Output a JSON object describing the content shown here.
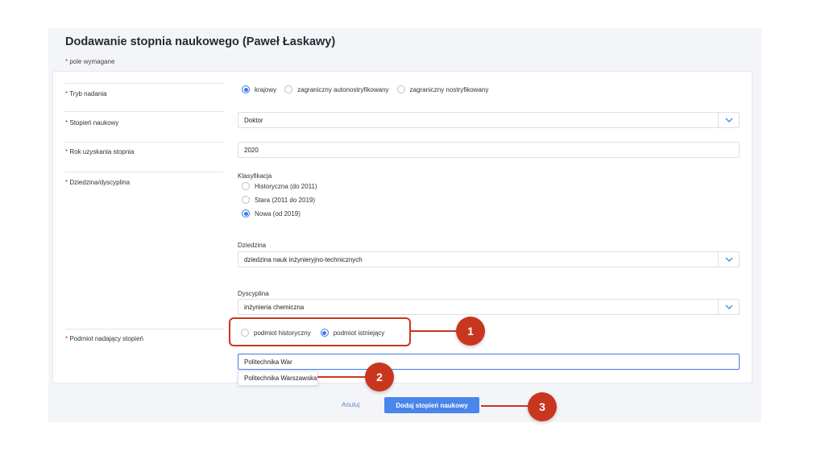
{
  "page": {
    "title": "Dodawanie stopnia naukowego (Paweł Łaskawy)",
    "required_star": "*",
    "required_note": "pole wymagane"
  },
  "form": {
    "tryb": {
      "label": "Tryb nadania",
      "options": [
        "krajowy",
        "zagraniczny autonostryfikowany",
        "zagraniczny nostryfikowany"
      ],
      "selected": "krajowy"
    },
    "stopien": {
      "label": "Stopień naukowy",
      "value": "Doktor"
    },
    "rok": {
      "label": "Rok uzyskania stopnia",
      "value": "2020"
    },
    "dziedzina_dyscyplina": {
      "label": "Dziedzina/dyscyplina",
      "klasyfikacja_label": "Klasyfikacja",
      "klasyfikacja_options": [
        "Historyczna (do 2011)",
        "Stara (2011 do 2019)",
        "Nowa (od 2019)"
      ],
      "klasyfikacja_selected": "Nowa (od 2019)",
      "dziedzina_label": "Dziedzina",
      "dziedzina_value": "dziedzina nauk inżynieryjno-technicznych",
      "dyscyplina_label": "Dyscyplina",
      "dyscyplina_value": "inżynieria chemiczna"
    },
    "podmiot": {
      "label": "Podmiot nadający stopień",
      "options": [
        "podmiot historyczny",
        "podmiot istniejący"
      ],
      "selected": "podmiot istniejący",
      "input_value": "Politechnika War",
      "suggestion": "Politechnika Warszawska"
    }
  },
  "actions": {
    "cancel_label": "Anuluj",
    "submit_label": "Dodaj stopień naukowy"
  },
  "annotations": {
    "badge_1": "1",
    "badge_2": "2",
    "badge_3": "3"
  },
  "colors": {
    "accent": "#4a86ea",
    "annotation": "#c9361f",
    "required": "#c62828"
  },
  "icons": {
    "dropdown": "chevron-down-icon"
  }
}
